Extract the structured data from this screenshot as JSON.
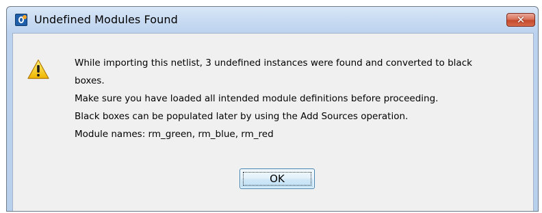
{
  "window": {
    "title": "Undefined Modules Found",
    "close_label": "✕",
    "app_icon": "app-logo-icon"
  },
  "dialog": {
    "icon": "warning-icon",
    "lines": [
      "While importing this netlist, 3 undefined instances were found and converted to black",
      "boxes.",
      "Make sure you have loaded all intended module definitions before proceeding.",
      "Black boxes can be populated later by using the Add Sources operation.",
      "Module names: rm_green, rm_blue, rm_red"
    ],
    "ok_label": "OK"
  },
  "colors": {
    "title_bar": "#c9dcf2",
    "close_button": "#c54a2c",
    "client_background": "#f0f0f0",
    "warning_yellow": "#f5c400"
  }
}
